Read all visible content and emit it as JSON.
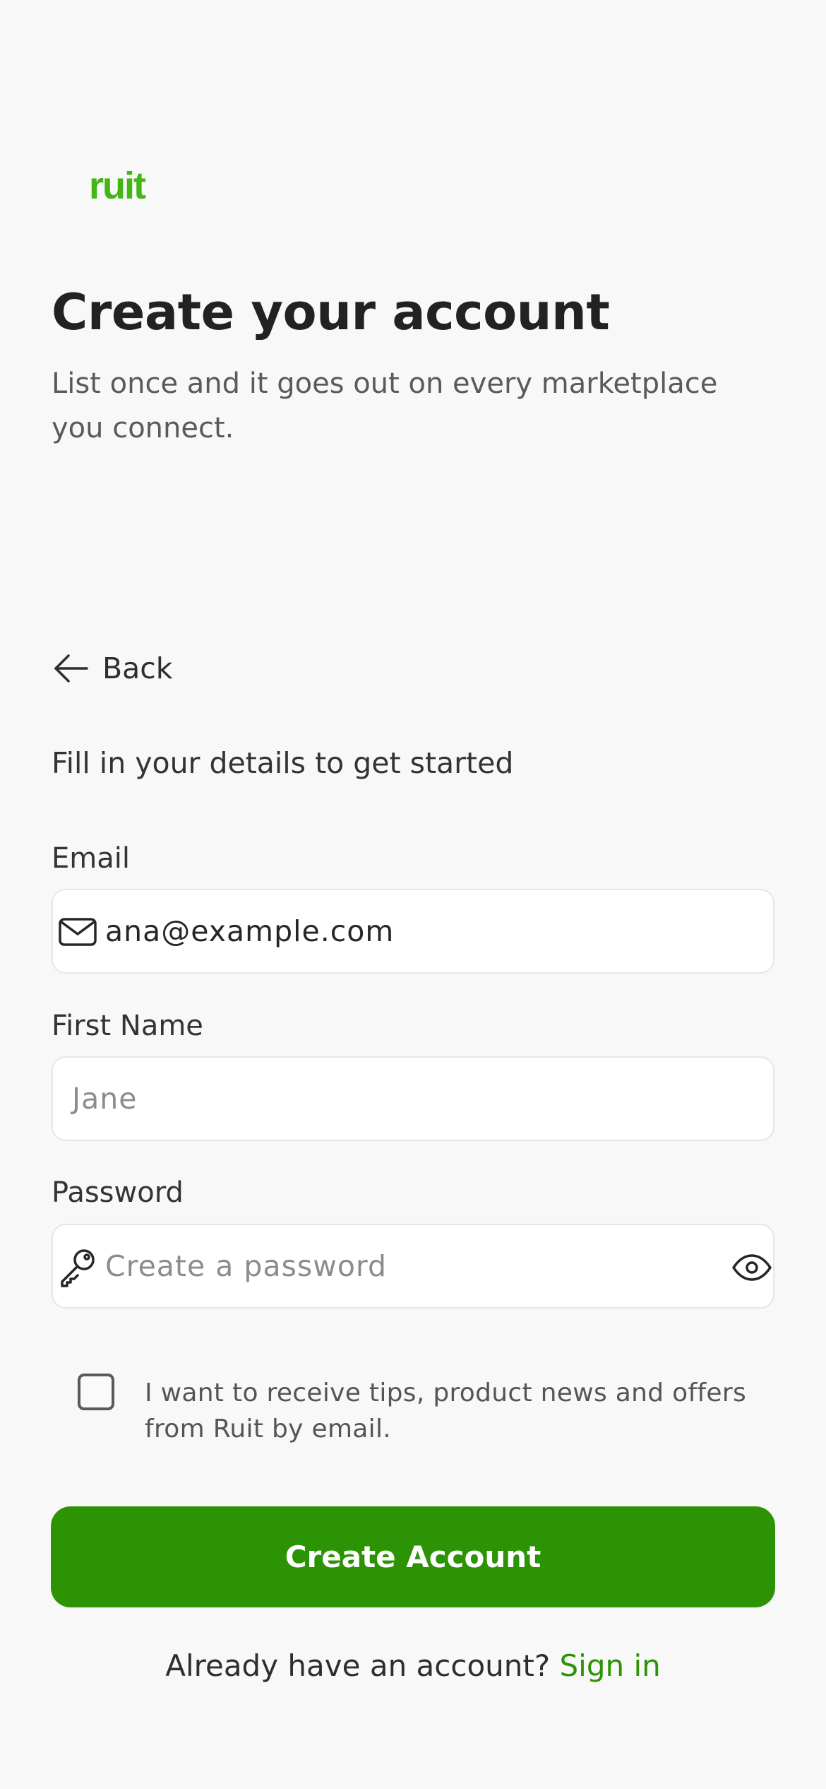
{
  "brand": {
    "logo_text": "ruit",
    "accent_color": "#2c9404",
    "logo_color": "#43b616"
  },
  "header": {
    "title": "Create your account",
    "subtitle": "List once and it goes out on every marketplace you connect."
  },
  "nav": {
    "back_label": "Back",
    "back_icon": "arrow-left-icon"
  },
  "form": {
    "intro": "Fill in your details to get started",
    "email": {
      "label": "Email",
      "value": "ana@example.com",
      "icon": "envelope-icon"
    },
    "first_name": {
      "label": "First Name",
      "placeholder": "Jane"
    },
    "password": {
      "label": "Password",
      "placeholder": "Create a password",
      "icon": "key-icon",
      "toggle_icon": "eye-icon"
    },
    "marketing_opt_in": {
      "checked": false,
      "label": "I want to receive tips, product news and offers from Ruit by email."
    },
    "submit_label": "Create Account"
  },
  "footer": {
    "prompt": "Already have an account?",
    "link_label": "Sign in"
  }
}
